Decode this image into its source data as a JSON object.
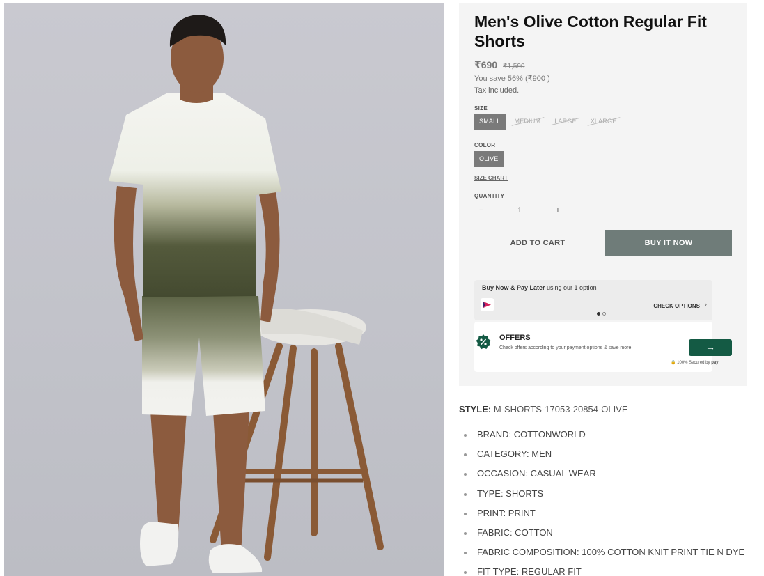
{
  "product": {
    "title": "Men's Olive Cotton Regular Fit Shorts",
    "price": "₹690",
    "mrp": "₹1,590",
    "savings": "You save 56% (₹900 )",
    "tax_note": "Tax included.",
    "image_icon": "model-photo"
  },
  "size": {
    "label": "SIZE",
    "options": [
      "SMALL",
      "MEDIUM",
      "LARGE",
      "XLARGE"
    ],
    "selected": "SMALL"
  },
  "color": {
    "label": "COLOR",
    "options": [
      "OLIVE"
    ],
    "selected": "OLIVE"
  },
  "size_chart_link": "SIZE CHART",
  "quantity": {
    "label": "QUANTITY",
    "minus": "−",
    "value": "1",
    "plus": "+"
  },
  "buttons": {
    "add_to_cart": "ADD TO CART",
    "buy_now": "BUY IT NOW"
  },
  "bnpl": {
    "text_bold": "Buy Now & Pay Later",
    "text_rest": " using our 1 option",
    "cta": "CHECK OPTIONS",
    "cta_icon": "chevron-right-icon"
  },
  "offers": {
    "title": "OFFERS",
    "subtitle": "Check offers according to your payment options & save more",
    "button_icon": "arrow-right-icon",
    "secured": "100% Secured by"
  },
  "style": {
    "label": "STYLE:",
    "value": " M-SHORTS-17053-20854-OLIVE"
  },
  "specs": [
    "BRAND: COTTONWORLD",
    "CATEGORY: MEN",
    "OCCASION: CASUAL WEAR",
    "TYPE: SHORTS",
    "PRINT: PRINT",
    "FABRIC: COTTON",
    "FABRIC COMPOSITION: 100% COTTON KNIT PRINT TIE N DYE",
    "FIT TYPE: REGULAR FIT"
  ],
  "colors": {
    "buy_button": "#6f7c79",
    "offers_button": "#145a44",
    "panel_bg": "#f4f4f4"
  }
}
